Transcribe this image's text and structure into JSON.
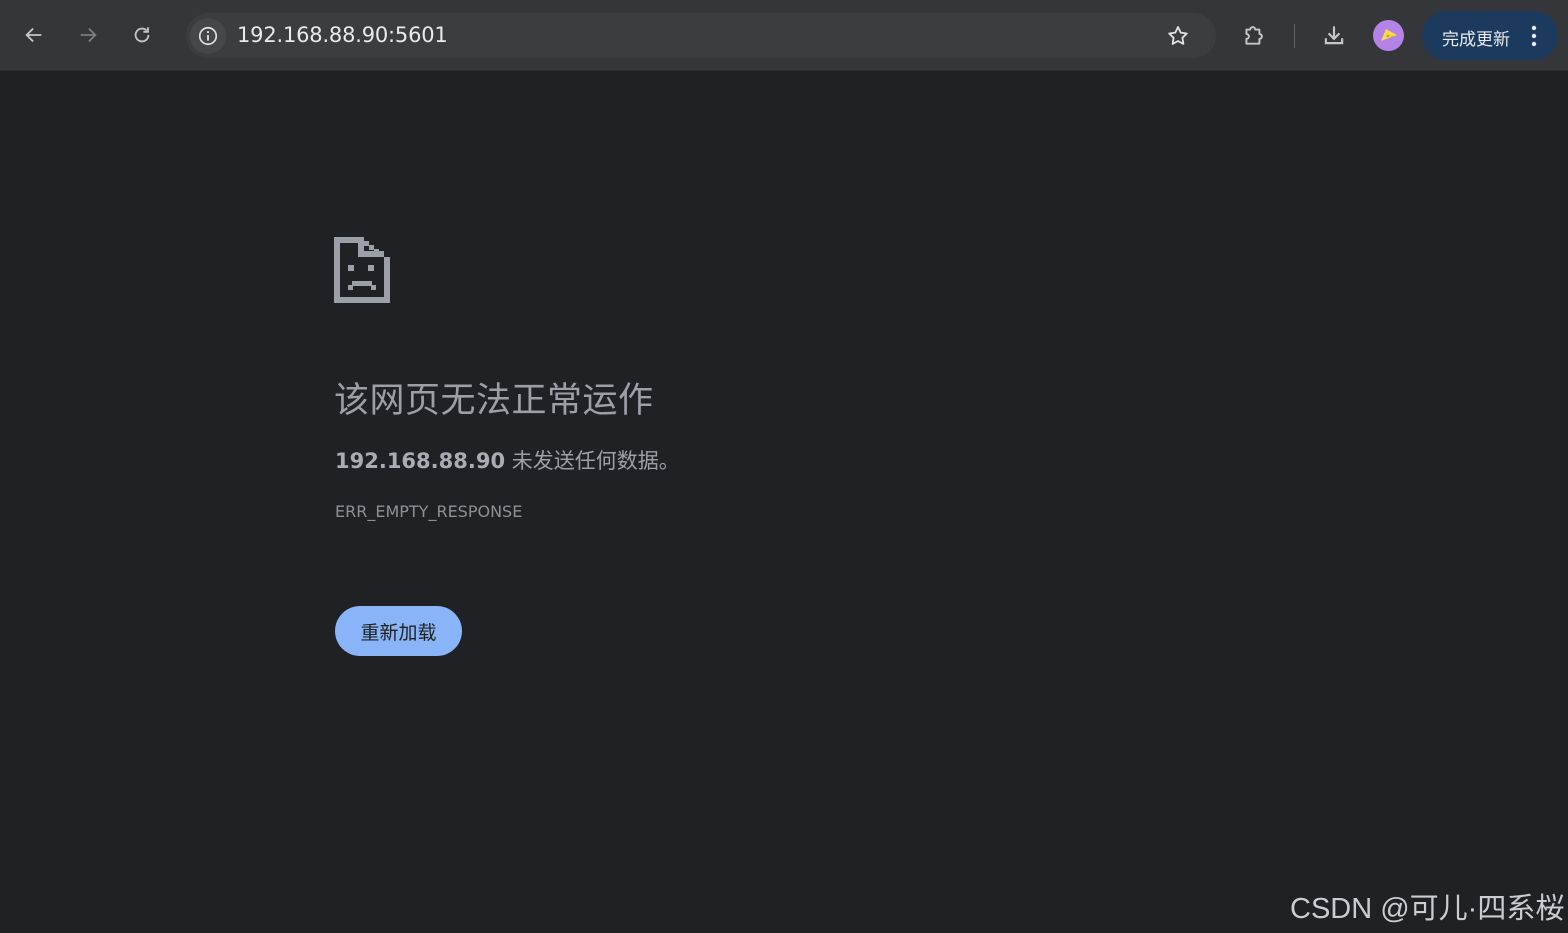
{
  "browser": {
    "url": "192.168.88.90:5601",
    "update_button_label": "完成更新",
    "colors": {
      "toolbar": "#35363a",
      "omnibox": "#3c3d41",
      "page_background": "#202124",
      "update_button": "#1c3a5e",
      "avatar": "#b583e8"
    }
  },
  "icons": {
    "back": "arrow-left-icon",
    "forward": "arrow-right-icon",
    "reload": "reload-icon",
    "site_info": "info-icon",
    "bookmark": "star-icon",
    "extensions": "puzzle-icon",
    "downloads": "download-icon",
    "profile": "avatar-icon",
    "menu": "kebab-menu-icon",
    "error": "sad-document-icon"
  },
  "error_page": {
    "title": "该网页无法正常运作",
    "host": "192.168.88.90",
    "message": " 未发送任何数据。",
    "code": "ERR_EMPTY_RESPONSE",
    "reload_label": "重新加载",
    "reload_color": "#8ab4f8"
  },
  "watermark": "CSDN @可儿·四系桜"
}
